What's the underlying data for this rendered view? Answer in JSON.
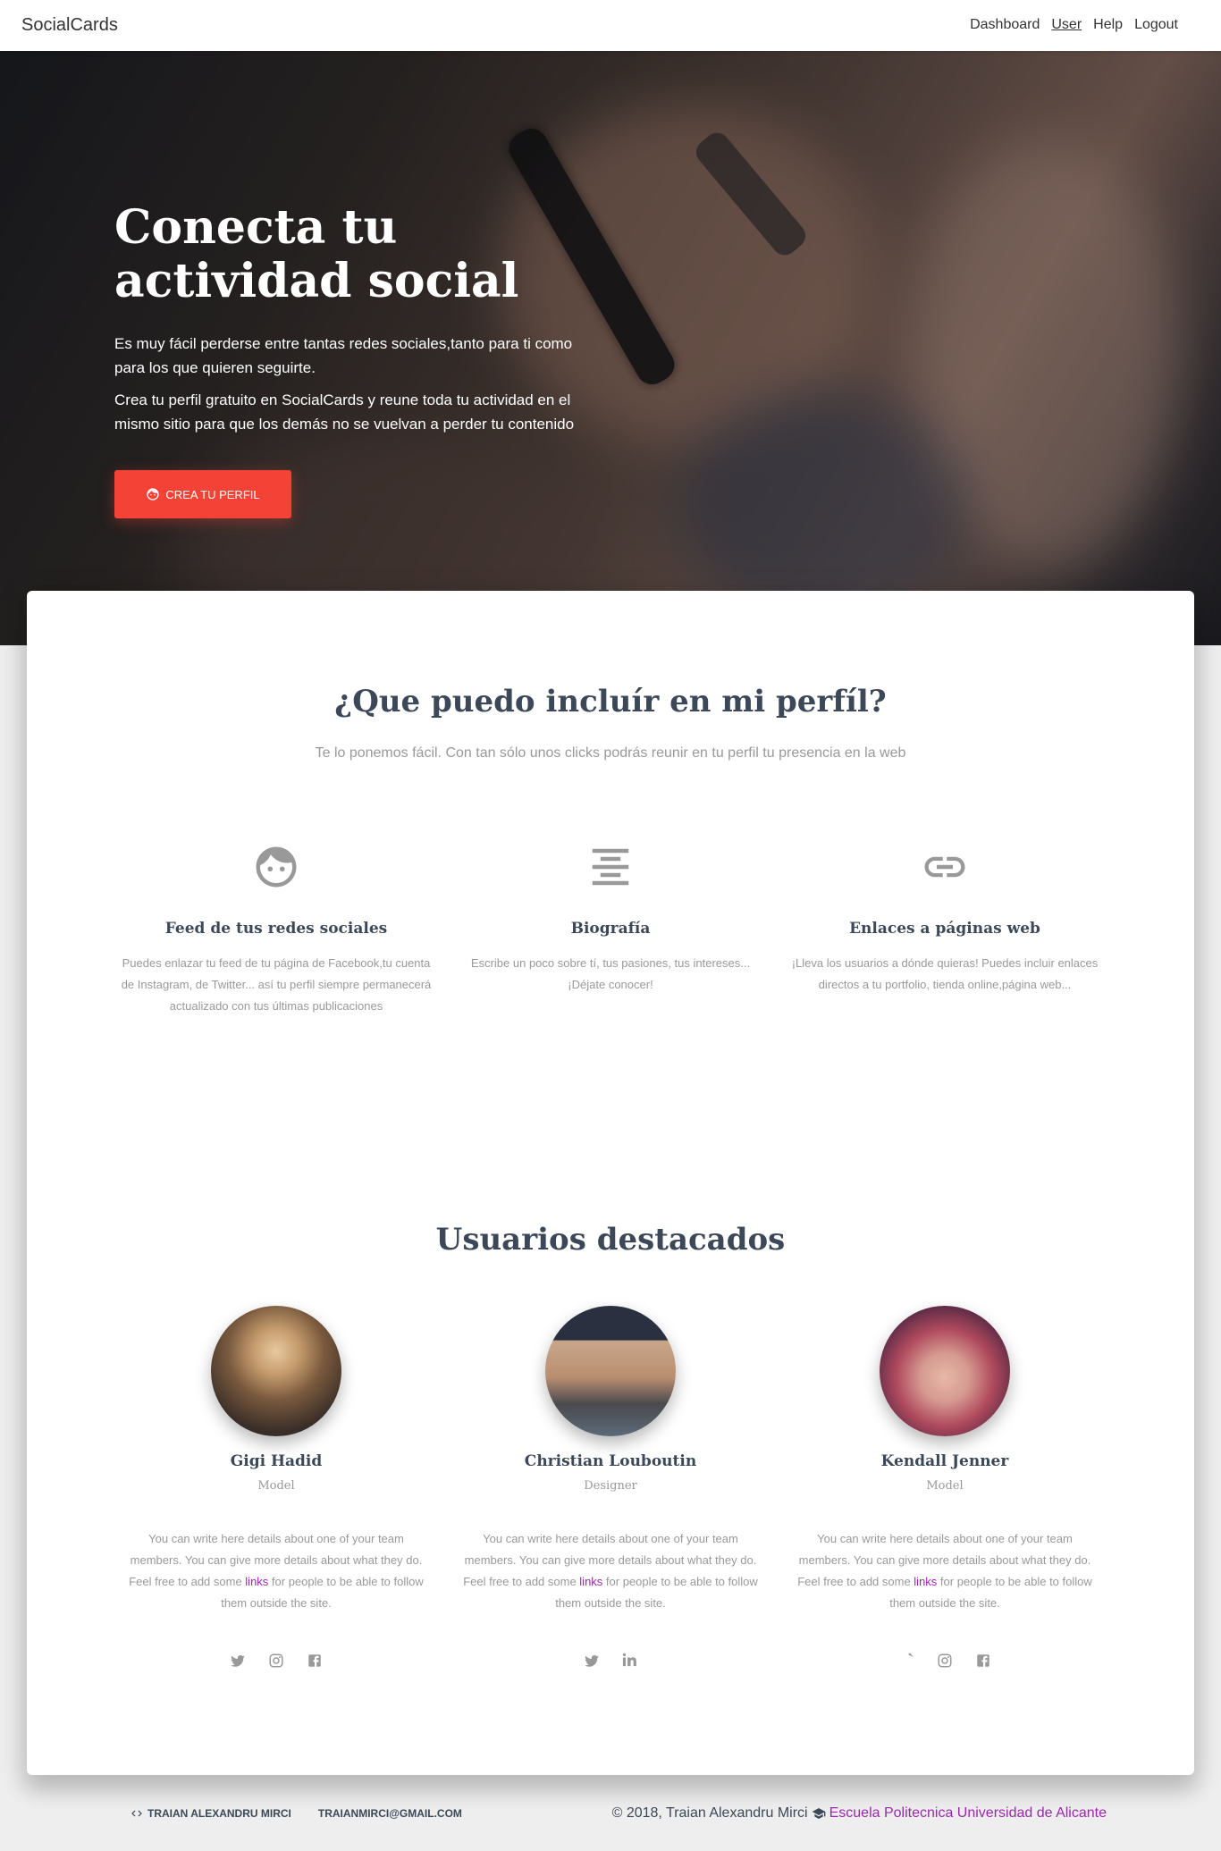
{
  "navbar": {
    "brand": "SocialCards",
    "links": [
      "Dashboard",
      "User",
      "Help",
      "Logout"
    ]
  },
  "hero": {
    "title": "Conecta tu actividad social",
    "text1": "Es muy fácil perderse entre tantas redes sociales,tanto para ti como para los que quieren seguirte.",
    "text2": "Crea tu perfil gratuito en SocialCards y reune toda tu actividad en el mismo sitio para que los demás no se vuelvan a perder tu contenido",
    "cta_label": "CREA TU PERFIL"
  },
  "features_section": {
    "title": "¿Que puedo incluír en mi perfíl?",
    "subtitle": "Te lo ponemos fácil. Con tan sólo unos clicks podrás reunir en tu perfil tu presencia en la web",
    "items": [
      {
        "icon": "face-icon",
        "title": "Feed de tus redes sociales",
        "text": "Puedes enlazar tu feed de tu página de Facebook,tu cuenta de Instagram, de Twitter... así tu perfil siempre permanecerá actualizado con tus últimas publicaciones"
      },
      {
        "icon": "format-align-center-icon",
        "title": "Biografía",
        "text": "Escribe un poco sobre tí, tus pasiones, tus intereses... ¡Déjate conocer!"
      },
      {
        "icon": "link-icon",
        "title": "Enlaces a páginas web",
        "text": "¡Lleva los usuarios a dónde quieras! Puedes incluir enlaces directos a tu portfolio, tienda online,página web..."
      }
    ]
  },
  "team_section": {
    "title": "Usuarios destacados",
    "members": [
      {
        "name": "Gigi Hadid",
        "role": "Model",
        "text_before": "You can write here details about one of your team members. You can give more details about what they do. Feel free to add some ",
        "link": "links",
        "text_after": " for people to be able to follow them outside the site.",
        "socials": [
          "twitter-icon",
          "instagram-icon",
          "facebook-icon"
        ]
      },
      {
        "name": "Christian Louboutin",
        "role": "Designer",
        "text_before": "You can write here details about one of your team members. You can give more details about what they do. Feel free to add some ",
        "link": "links",
        "text_after": " for people to be able to follow them outside the site.",
        "socials": [
          "twitter-icon",
          "linkedin-icon"
        ]
      },
      {
        "name": "Kendall Jenner",
        "role": "Model",
        "text_before": "You can write here details about one of your team members. You can give more details about what they do. Feel free to add some ",
        "link": "links",
        "text_after": " for people to be able to follow them outside the site.",
        "socials": [
          "twitter-icon",
          "instagram-icon",
          "facebook-icon"
        ]
      }
    ]
  },
  "footer": {
    "author": "TRAIAN ALEXANDRU MIRCI",
    "email": "TRAIANMIRCI@GMAIL.COM",
    "copyright": "© 2018, Traian Alexandru Mirci",
    "school": "Escuela Politecnica Universidad de Alicante"
  },
  "colors": {
    "accent": "#f44336",
    "link": "#9c27b0",
    "heading": "#3c4858",
    "muted": "#999999"
  }
}
